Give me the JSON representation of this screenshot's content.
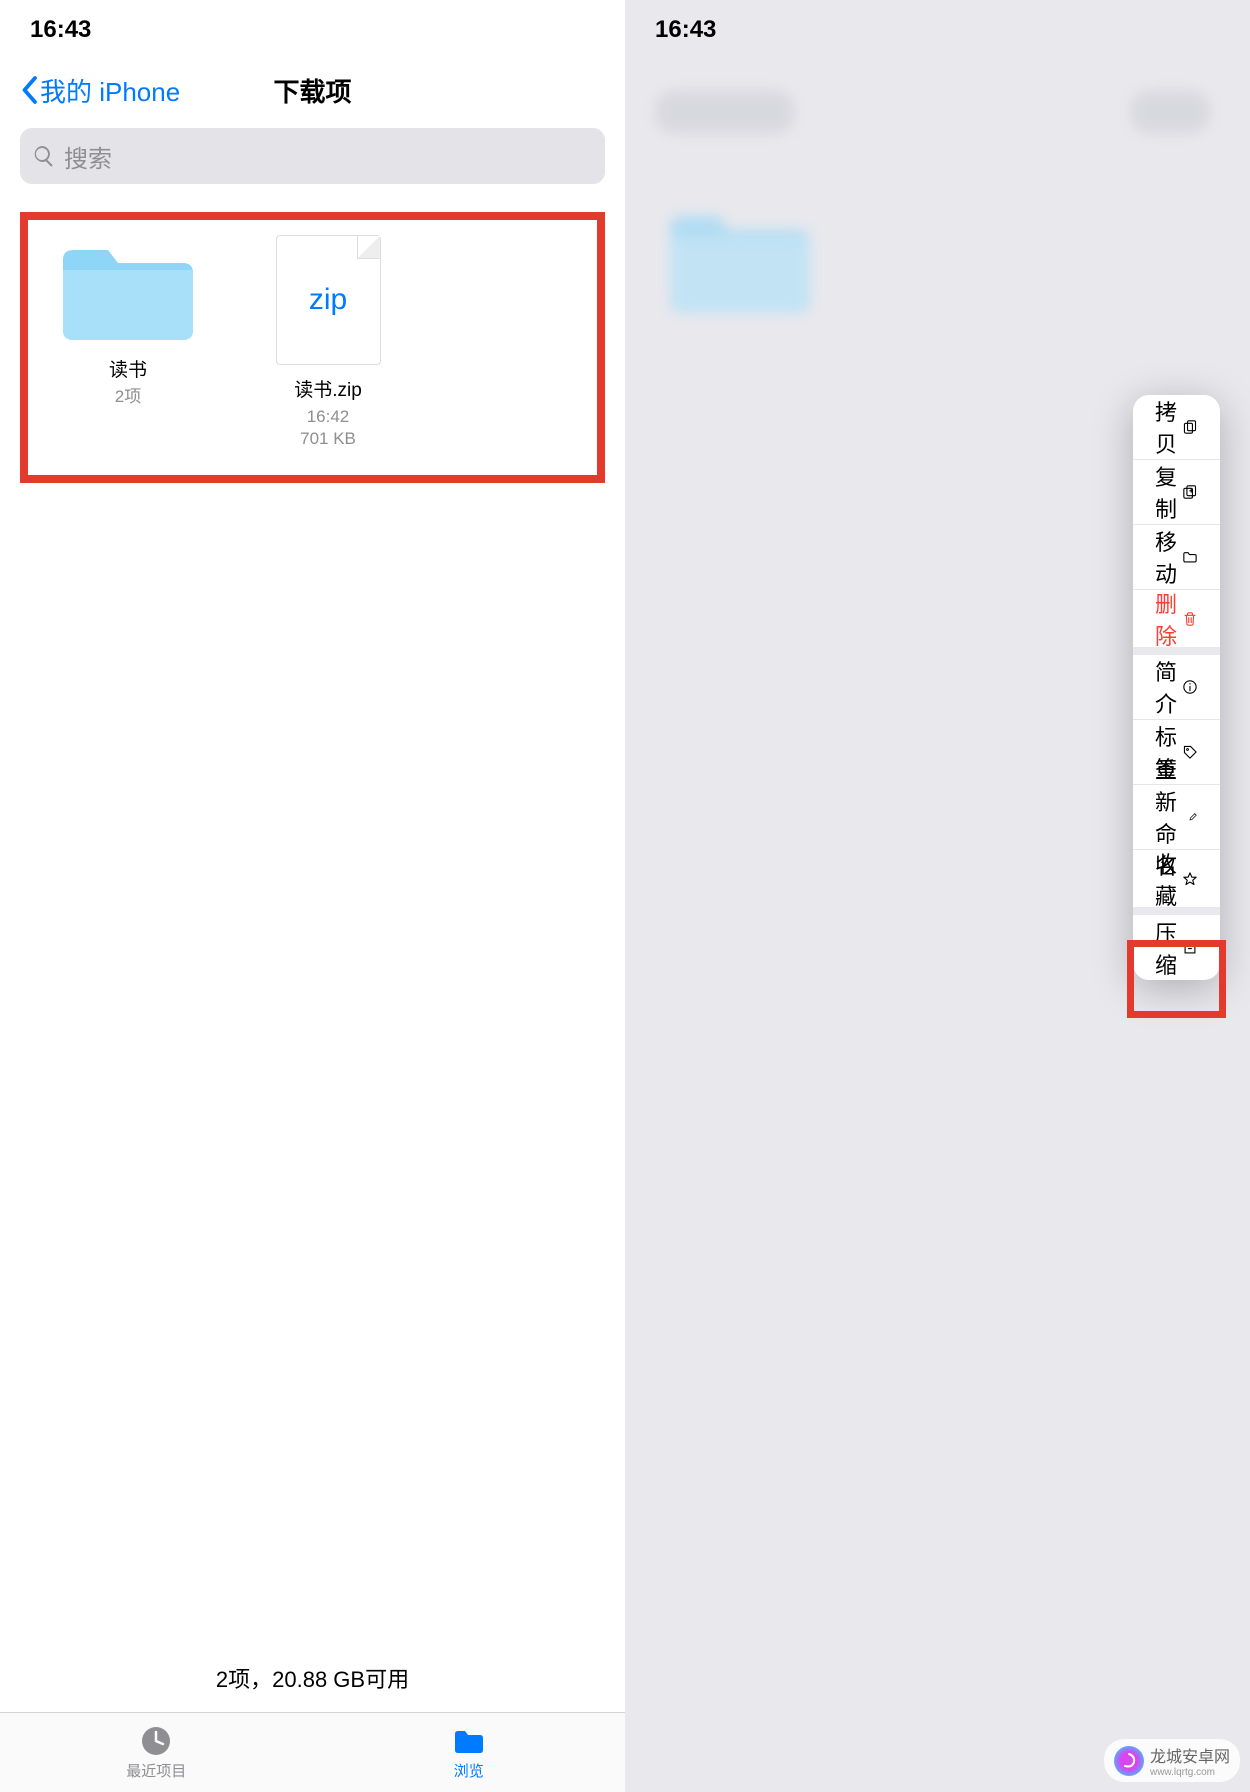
{
  "left": {
    "time": "16:43",
    "back": "我的 iPhone",
    "title": "下载项",
    "search_placeholder": "搜索",
    "items": [
      {
        "name": "读书",
        "meta": "2项"
      },
      {
        "name": "读书.zip",
        "time": "16:42",
        "size": "701 KB",
        "zip_label": "zip"
      }
    ],
    "bottom_status": "2项，20.88 GB可用",
    "tabs": {
      "recent": "最近项目",
      "browse": "浏览"
    }
  },
  "right": {
    "time": "16:43",
    "menu": [
      {
        "label": "拷贝",
        "icon": "copy"
      },
      {
        "label": "复制",
        "icon": "duplicate"
      },
      {
        "label": "移动",
        "icon": "folder"
      },
      {
        "label": "删除",
        "icon": "trash",
        "danger": true,
        "sep": true
      },
      {
        "label": "简介",
        "icon": "info"
      },
      {
        "label": "标签",
        "icon": "tag"
      },
      {
        "label": "重新命名",
        "icon": "pencil"
      },
      {
        "label": "收藏",
        "icon": "star",
        "sep": true
      },
      {
        "label": "压缩",
        "icon": "archive"
      }
    ]
  },
  "watermark": {
    "text": "龙城安卓网",
    "url": "www.lqrtg.com"
  }
}
